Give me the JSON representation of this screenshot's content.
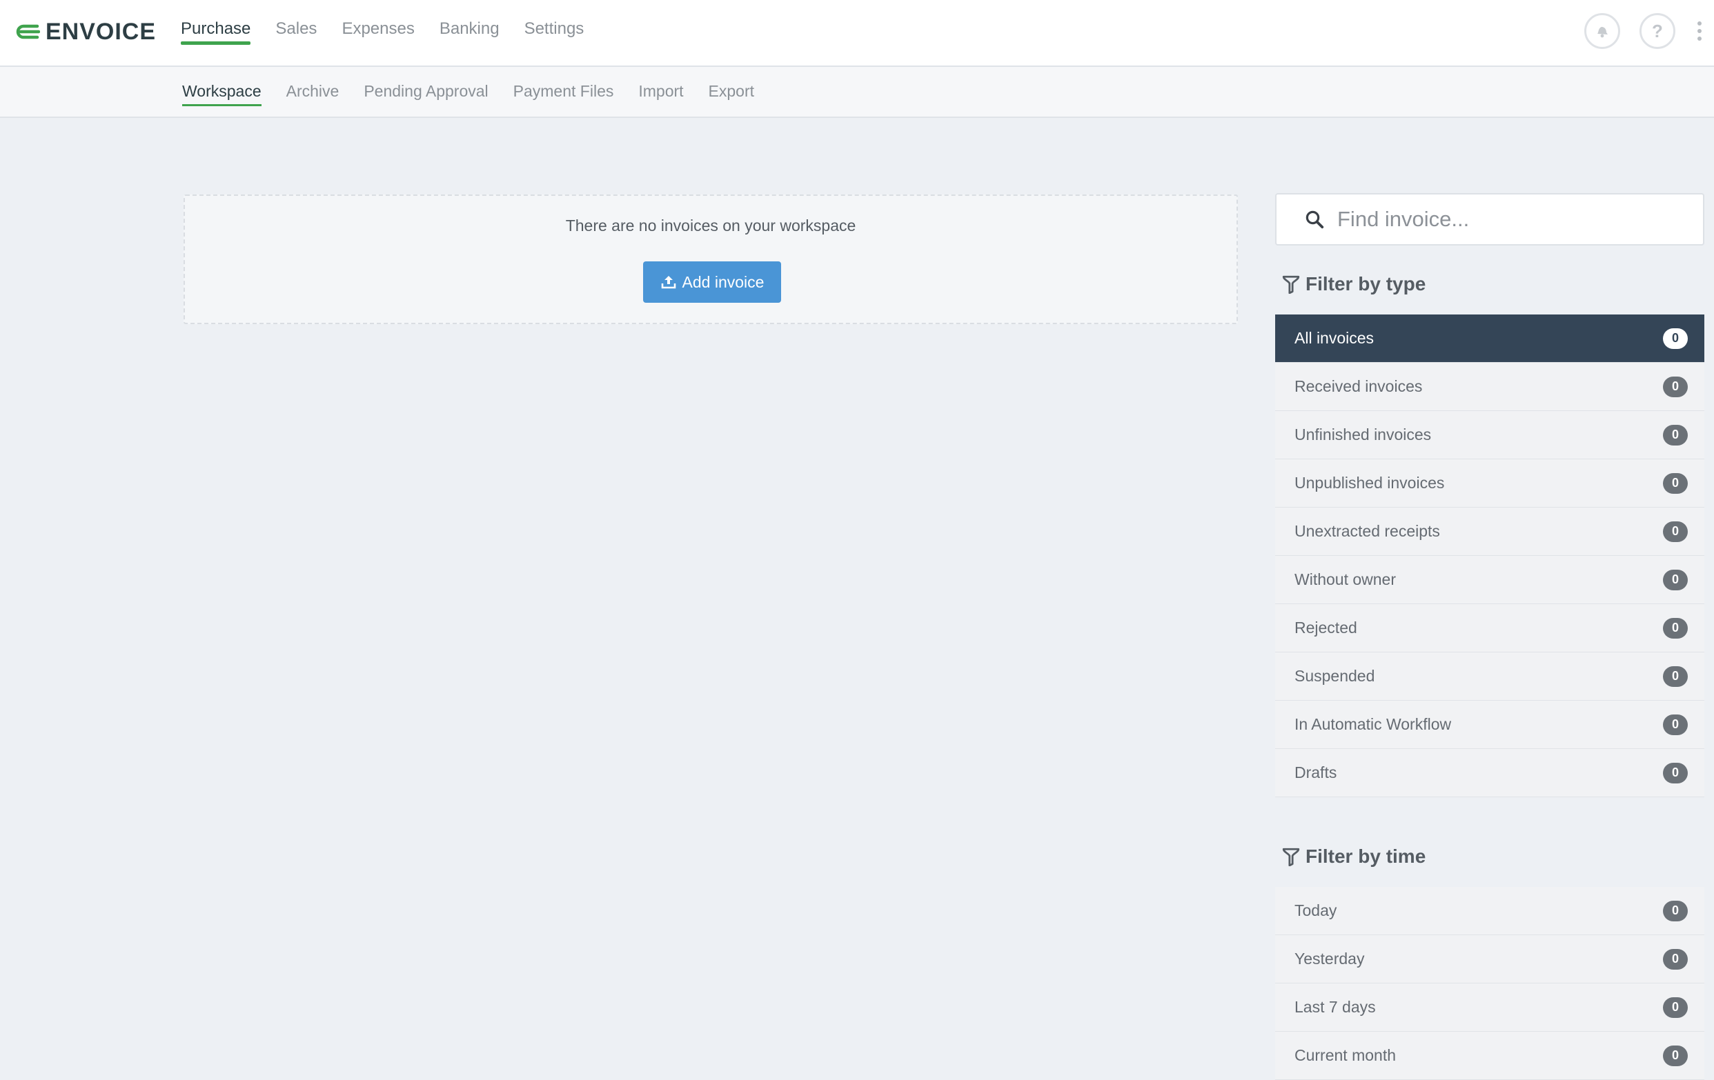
{
  "app": {
    "name": "ENVOICE",
    "accent_color": "#3fa34d",
    "primary_button_color": "#4a95d6"
  },
  "main_nav": {
    "items": [
      {
        "label": "Purchase",
        "active": true
      },
      {
        "label": "Sales",
        "active": false
      },
      {
        "label": "Expenses",
        "active": false
      },
      {
        "label": "Banking",
        "active": false
      },
      {
        "label": "Settings",
        "active": false
      }
    ]
  },
  "header_icons": {
    "notifications": "bell-icon",
    "help": "?",
    "menu": "more-vertical-icon"
  },
  "sub_nav": {
    "items": [
      {
        "label": "Workspace",
        "active": true
      },
      {
        "label": "Archive",
        "active": false
      },
      {
        "label": "Pending Approval",
        "active": false
      },
      {
        "label": "Payment Files",
        "active": false
      },
      {
        "label": "Import",
        "active": false
      },
      {
        "label": "Export",
        "active": false
      }
    ]
  },
  "workspace": {
    "empty_message": "There are no invoices on your workspace",
    "add_button_label": "Add invoice",
    "add_button_icon": "upload-icon"
  },
  "search": {
    "placeholder": "Find invoice...",
    "value": "",
    "icon": "search-icon"
  },
  "filter_by_type": {
    "heading": "Filter by type",
    "icon": "filter-icon",
    "items": [
      {
        "label": "All invoices",
        "count": "0",
        "active": true
      },
      {
        "label": "Received invoices",
        "count": "0",
        "active": false
      },
      {
        "label": "Unfinished invoices",
        "count": "0",
        "active": false
      },
      {
        "label": "Unpublished invoices",
        "count": "0",
        "active": false
      },
      {
        "label": "Unextracted receipts",
        "count": "0",
        "active": false
      },
      {
        "label": "Without owner",
        "count": "0",
        "active": false
      },
      {
        "label": "Rejected",
        "count": "0",
        "active": false
      },
      {
        "label": "Suspended",
        "count": "0",
        "active": false
      },
      {
        "label": "In Automatic Workflow",
        "count": "0",
        "active": false
      },
      {
        "label": "Drafts",
        "count": "0",
        "active": false
      }
    ]
  },
  "filter_by_time": {
    "heading": "Filter by time",
    "icon": "filter-icon",
    "items": [
      {
        "label": "Today",
        "count": "0",
        "active": false
      },
      {
        "label": "Yesterday",
        "count": "0",
        "active": false
      },
      {
        "label": "Last 7 days",
        "count": "0",
        "active": false
      },
      {
        "label": "Current month",
        "count": "0",
        "active": false
      }
    ]
  }
}
